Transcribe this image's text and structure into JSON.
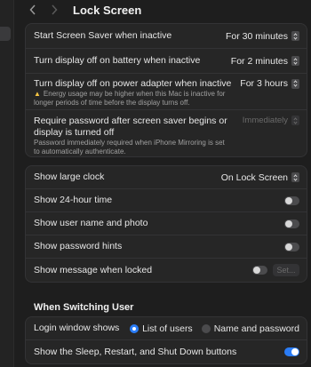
{
  "window": {
    "title": "Lock Screen"
  },
  "colors": {
    "accent": "#2a7cf6",
    "warning": "#f5c542"
  },
  "security": {
    "screen_saver": {
      "label": "Start Screen Saver when inactive",
      "value": "For 30 minutes"
    },
    "display_battery": {
      "label": "Turn display off on battery when inactive",
      "value": "For 2 minutes"
    },
    "display_power": {
      "label": "Turn display off on power adapter when inactive",
      "value": "For 3 hours",
      "warning_icon": "warning-icon",
      "warning_line1": "Energy usage may be higher when this Mac is inactive for",
      "warning_line2": "longer periods of time before the display turns off."
    },
    "require_password": {
      "label_line1": "Require password after screen saver begins or",
      "label_line2": "display is turned off",
      "value": "Immediately",
      "note_line1": "Password immediately required when iPhone Mirroring is set",
      "note_line2": "to automatically authenticate."
    }
  },
  "display": {
    "large_clock": {
      "label": "Show large clock",
      "value": "On Lock Screen"
    },
    "clock_24h": {
      "label": "Show 24-hour time",
      "on": false
    },
    "user_name_photo": {
      "label": "Show user name and photo",
      "on": false
    },
    "password_hints": {
      "label": "Show password hints",
      "on": false
    },
    "message_locked": {
      "label": "Show message when locked",
      "on": false,
      "set_label": "Set..."
    }
  },
  "switching": {
    "header": "When Switching User",
    "login_window": {
      "label": "Login window shows",
      "options": [
        "List of users",
        "Name and password"
      ],
      "selected": "List of users"
    },
    "sleep_restart": {
      "label": "Show the Sleep, Restart, and Shut Down buttons",
      "on": true
    }
  }
}
